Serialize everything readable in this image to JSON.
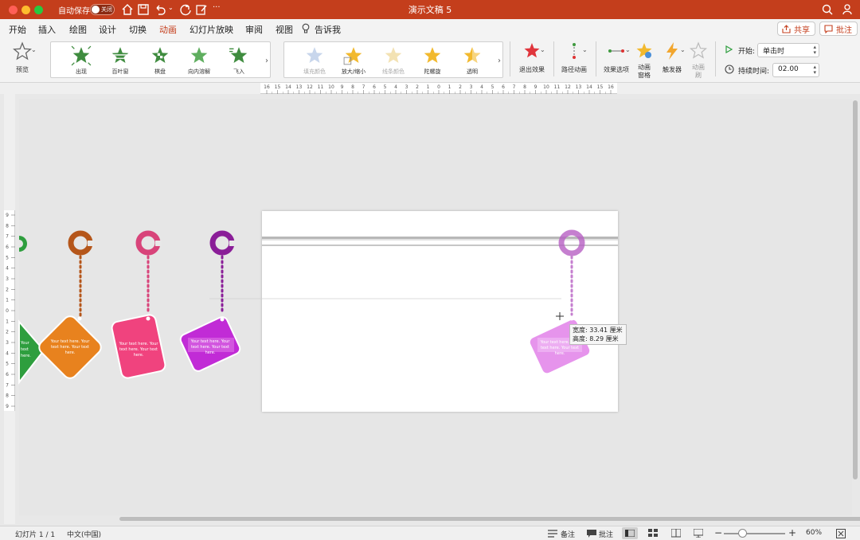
{
  "window": {
    "title": "演示文稿 5",
    "autosave_label": "自动保存",
    "autosave_state": "关闭"
  },
  "tabs": [
    {
      "label": "开始"
    },
    {
      "label": "插入"
    },
    {
      "label": "绘图"
    },
    {
      "label": "设计"
    },
    {
      "label": "切换"
    },
    {
      "label": "动画"
    },
    {
      "label": "幻灯片放映"
    },
    {
      "label": "审阅"
    },
    {
      "label": "视图"
    },
    {
      "label": "告诉我"
    }
  ],
  "active_tab": "动画",
  "share_label": "共享",
  "comment_label": "批注",
  "ribbon": {
    "preview_label": "预览",
    "entrance_effects": [
      "出现",
      "百叶窗",
      "棋盘",
      "向内溶解",
      "飞入"
    ],
    "emphasis_effects": [
      "填充颜色",
      "放大/缩小",
      "线条颜色",
      "陀螺旋",
      "透明"
    ],
    "exit_label": "退出效果",
    "path_label": "路径动画",
    "options_label": "效果选项",
    "pane_label_1": "动画",
    "pane_label_2": "窗格",
    "trigger_label": "触发器",
    "painter_label_1": "动画",
    "painter_label_2": "刷",
    "start_label": "开始:",
    "start_value": "单击时",
    "duration_label": "持续时间:",
    "duration_value": "02.00"
  },
  "ruler_top_labels": [
    "16",
    "15",
    "14",
    "13",
    "12",
    "11",
    "10",
    "9",
    "8",
    "7",
    "6",
    "5",
    "4",
    "3",
    "2",
    "1",
    "0",
    "1",
    "2",
    "3",
    "4",
    "5",
    "6",
    "7",
    "8",
    "9",
    "10",
    "11",
    "12",
    "13",
    "14",
    "15",
    "16"
  ],
  "ruler_side_labels": [
    "9",
    "8",
    "7",
    "6",
    "5",
    "4",
    "3",
    "2",
    "1",
    "0",
    "1",
    "2",
    "3",
    "4",
    "5",
    "6",
    "7",
    "8",
    "9"
  ],
  "card_text": "Your text here. Your text here. Your text here.",
  "colors": {
    "accent": "#c43e1c",
    "green": "#2e9e3e",
    "orange": "#e8821e",
    "orange_dark": "#b5561a",
    "pink": "#f0437e",
    "pink_ring": "#d8447a",
    "purple": "#c12bd6",
    "purple_ring": "#8a1e98",
    "violet_faded": "#e07ae8"
  },
  "size_tooltip": {
    "width_label": "宽度: 33.41 厘米",
    "height_label": "高度: 8.29 厘米"
  },
  "status": {
    "slide_counter": "幻灯片 1 / 1",
    "language": "中文(中国)",
    "notes_label": "备注",
    "comments_label": "批注",
    "zoom": "60%"
  }
}
